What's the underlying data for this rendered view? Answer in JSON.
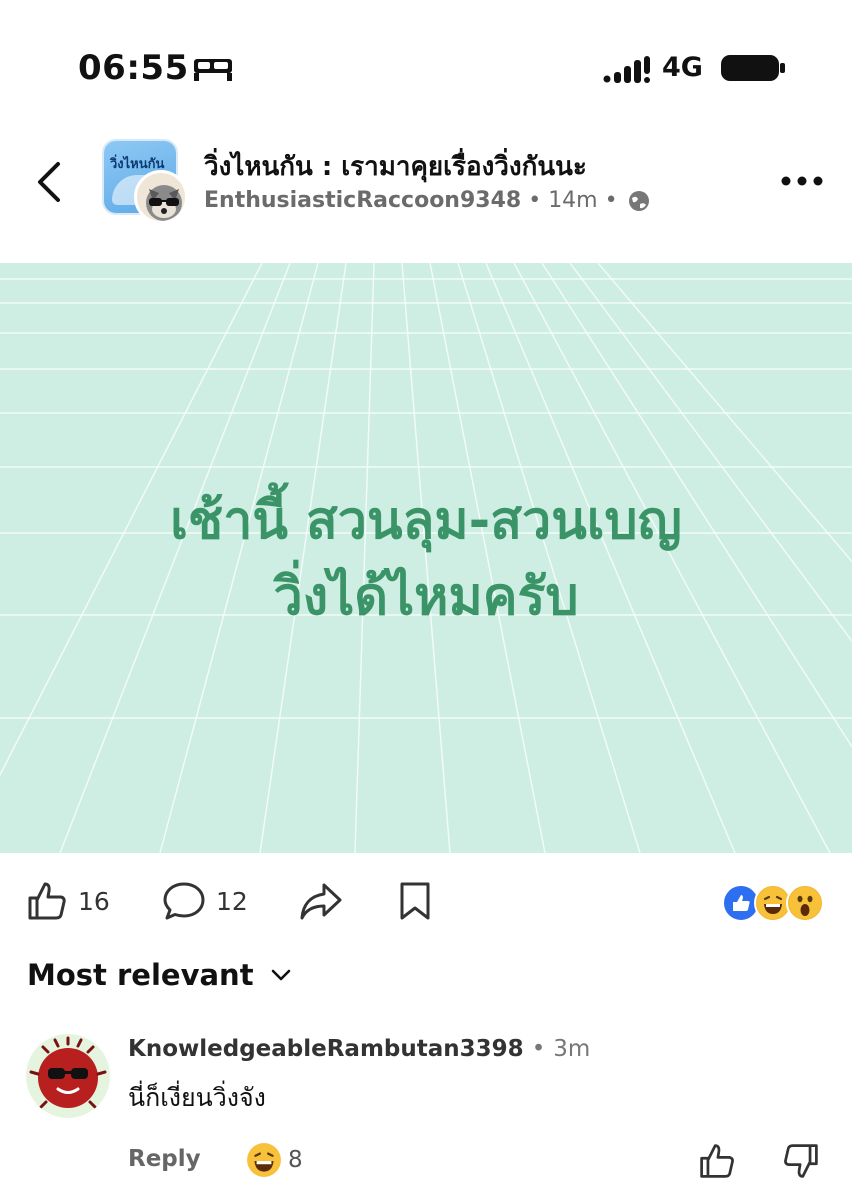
{
  "status_bar": {
    "time": "06:55",
    "network": "4G",
    "icons": [
      "bed-icon",
      "signal-icon",
      "battery-icon"
    ]
  },
  "post": {
    "group_name": "วิ่งไหนกัน : เรามาคุยเรื่องวิ่งกันนะ",
    "group_avatar_text": "วิ่งไหนกัน",
    "author": "EnthusiasticRaccoon9348",
    "separator": "•",
    "time": "14m",
    "image_text_line1": "เช้านี้ สวนลุม-สวนเบญ",
    "image_text_line2": "วิ่งได้ไหมครับ",
    "image_bg_color": "#cfeee3",
    "image_text_color": "#3b9468"
  },
  "actions": {
    "like_count": "16",
    "comment_count": "12",
    "reactions": [
      "like",
      "laugh",
      "wow"
    ]
  },
  "comments_section": {
    "sort_label": "Most relevant",
    "comments": [
      {
        "author": "KnowledgeableRambutan3398",
        "separator": "•",
        "time": "3m",
        "text": "นี่ก็เงี่ยนวิ่งจัง",
        "reply_label": "Reply",
        "reaction": "laugh",
        "reaction_count": "8"
      }
    ]
  }
}
